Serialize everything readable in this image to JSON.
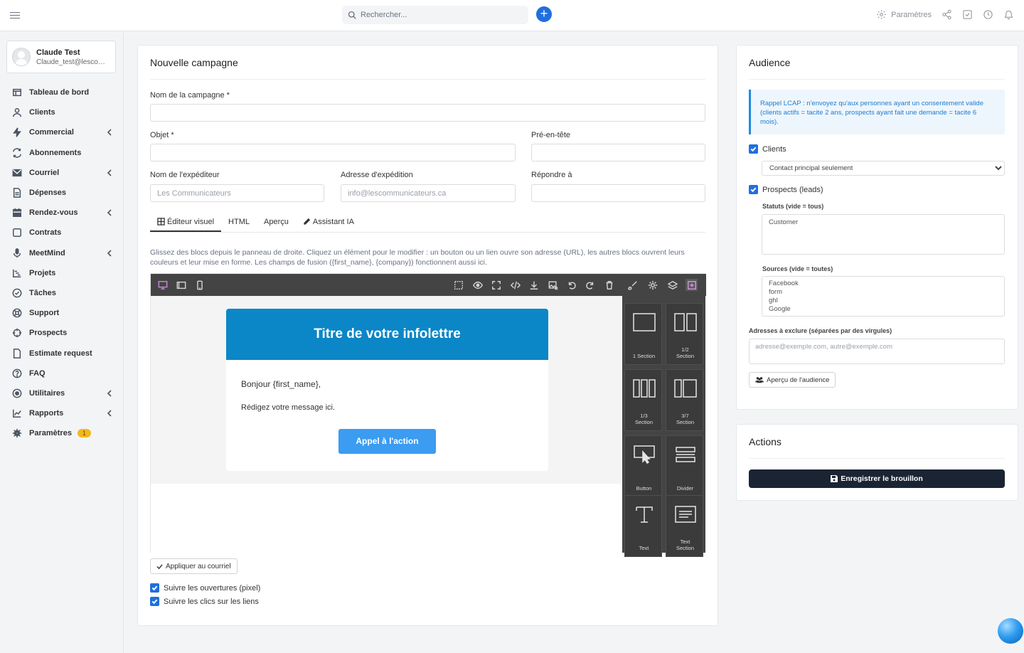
{
  "topbar": {
    "search_placeholder": "Rechercher...",
    "settings_label": "Paramètres"
  },
  "user": {
    "name": "Claude Test",
    "email": "Claude_test@lescommunicateurs.ca"
  },
  "sidebar": {
    "items": [
      {
        "label": "Tableau de bord",
        "icon": "dashboard-icon",
        "chevron": false
      },
      {
        "label": "Clients",
        "icon": "user-icon",
        "chevron": false
      },
      {
        "label": "Commercial",
        "icon": "bolt-icon",
        "chevron": true
      },
      {
        "label": "Abonnements",
        "icon": "refresh-icon",
        "chevron": false
      },
      {
        "label": "Courriel",
        "icon": "envelope-icon",
        "chevron": true
      },
      {
        "label": "Dépenses",
        "icon": "file-icon",
        "chevron": false
      },
      {
        "label": "Rendez-vous",
        "icon": "calendar-icon",
        "chevron": true
      },
      {
        "label": "Contrats",
        "icon": "contract-icon",
        "chevron": false
      },
      {
        "label": "MeetMind",
        "icon": "microphone-icon",
        "chevron": true
      },
      {
        "label": "Projets",
        "icon": "gantt-icon",
        "chevron": false
      },
      {
        "label": "Tâches",
        "icon": "check-circle-icon",
        "chevron": false
      },
      {
        "label": "Support",
        "icon": "lifebuoy-icon",
        "chevron": false
      },
      {
        "label": "Prospects",
        "icon": "crosshair-icon",
        "chevron": false
      },
      {
        "label": "Estimate request",
        "icon": "document-icon",
        "chevron": false
      },
      {
        "label": "FAQ",
        "icon": "question-icon",
        "chevron": false
      },
      {
        "label": "Utilitaires",
        "icon": "circle-dot-icon",
        "chevron": true
      },
      {
        "label": "Rapports",
        "icon": "chart-line-icon",
        "chevron": true
      },
      {
        "label": "Paramètres",
        "icon": "gear-icon",
        "chevron": false,
        "badge": "1"
      }
    ]
  },
  "campaign": {
    "title": "Nouvelle campagne",
    "name_label": "Nom de la campagne *",
    "subject_label": "Objet *",
    "preheader_label": "Pré-en-tête",
    "sender_name_label": "Nom de l'expéditeur",
    "sender_name_placeholder": "Les Communicateurs",
    "sender_email_label": "Adresse d'expédition",
    "sender_email_placeholder": "info@lescommunicateurs.ca",
    "reply_to_label": "Répondre à",
    "tabs": [
      "Éditeur visuel",
      "HTML",
      "Aperçu",
      "Assistant IA"
    ],
    "help": "Glissez des blocs depuis le panneau de droite. Cliquez un élément pour le modifier : un bouton ou un lien ouvre son adresse (URL), les autres blocs ouvrent leurs couleurs et leur mise en forme. Les champs de fusion ({first_name}, {company}) fonctionnent aussi ici.",
    "apply_label": "Appliquer au courriel",
    "track_opens": "Suivre les ouvertures (pixel)",
    "track_clicks": "Suivre les clics sur les liens"
  },
  "email": {
    "header_title": "Titre de votre infolettre",
    "greeting": "Bonjour {first_name},",
    "body": "Rédigez votre message ici.",
    "cta": "Appel à l'action"
  },
  "blocks": [
    {
      "label1": "",
      "label2": "1 Section"
    },
    {
      "label1": "1/2",
      "label2": "Section"
    },
    {
      "label1": "1/3",
      "label2": "Section"
    },
    {
      "label1": "3/7",
      "label2": "Section"
    },
    {
      "label1": "",
      "label2": "Button"
    },
    {
      "label1": "",
      "label2": "Divider"
    },
    {
      "label1": "",
      "label2": "Text"
    },
    {
      "label1": "Text",
      "label2": "Section"
    }
  ],
  "audience": {
    "title": "Audience",
    "note": "Rappel LCAP : n'envoyez qu'aux personnes ayant un consentement valide (clients actifs = tacite 2 ans, prospects ayant fait une demande = tacite 6 mois).",
    "clients_label": "Clients",
    "clients_select": "Contact principal seulement",
    "prospects_label": "Prospects (leads)",
    "statuses_label": "Statuts (vide = tous)",
    "statuses": [
      "Customer"
    ],
    "sources_label": "Sources (vide = toutes)",
    "sources": [
      "Facebook",
      "form",
      "ghl",
      "Google"
    ],
    "exclude_label": "Adresses à exclure (séparées par des virgules)",
    "exclude_placeholder": "adresse@exemple.com, autre@exemple.com",
    "preview_button": "Aperçu de l'audience"
  },
  "actions": {
    "title": "Actions",
    "save_button": "Enregistrer le brouillon"
  }
}
